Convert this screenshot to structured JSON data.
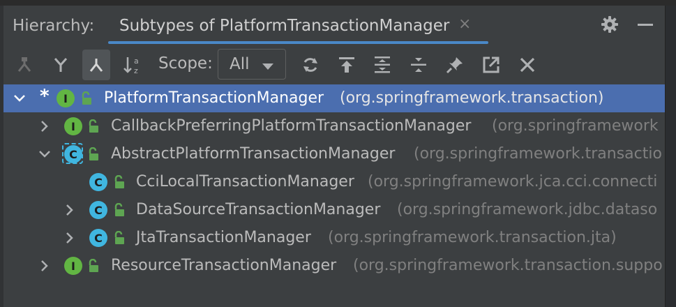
{
  "header": {
    "title": "Hierarchy:",
    "active_tab": "Subtypes of PlatformTransactionManager",
    "tab_close": "×"
  },
  "toolbar": {
    "scope_label": "Scope:",
    "scope_value": "All"
  },
  "tree": {
    "rows": [
      {
        "marker": "*",
        "kind": "I",
        "name": "PlatformTransactionManager",
        "package": "(org.springframework.transaction)"
      },
      {
        "kind": "I",
        "name": "CallbackPreferringPlatformTransactionManager",
        "package": "(org.springframework"
      },
      {
        "kind": "C",
        "name": "AbstractPlatformTransactionManager",
        "package": "(org.springframework.transactio"
      },
      {
        "kind": "C",
        "name": "CciLocalTransactionManager",
        "package": "(org.springframework.jca.cci.connecti"
      },
      {
        "kind": "C",
        "name": "DataSourceTransactionManager",
        "package": "(org.springframework.jdbc.dataso"
      },
      {
        "kind": "C",
        "name": "JtaTransactionManager",
        "package": "(org.springframework.transaction.jta)"
      },
      {
        "kind": "I",
        "name": "ResourceTransactionManager",
        "package": "(org.springframework.transaction.suppo"
      }
    ]
  },
  "colors": {
    "background": "#3c3f41",
    "selection": "#4b6eaf",
    "accent_underline": "#4a88c7",
    "interface_badge": "#62b543",
    "class_badge": "#40b6e0",
    "lock": "#5ea552"
  }
}
